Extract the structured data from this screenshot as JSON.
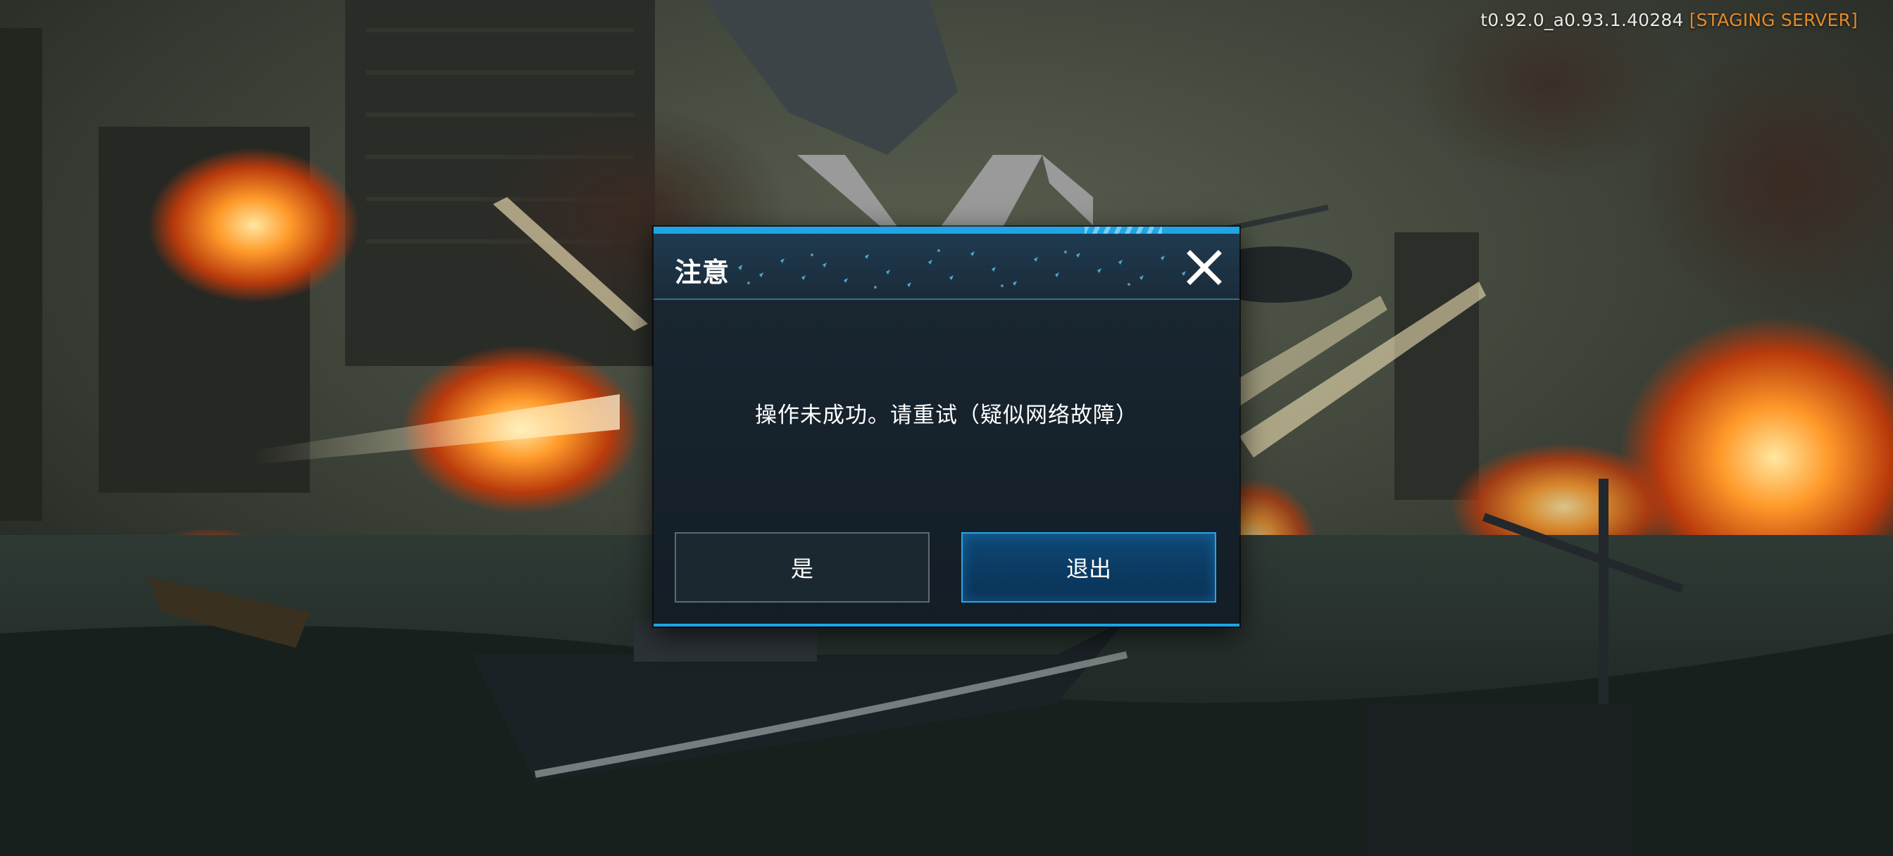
{
  "build": {
    "version": "t0.92.0_a0.93.1.40284",
    "server_tag": "[STAGING SERVER]"
  },
  "dialog": {
    "title": "注意",
    "message": "操作未成功。请重试（疑似网络故障）",
    "confirm_label": "是",
    "exit_label": "退出",
    "close_icon": "close-icon"
  },
  "colors": {
    "accent": "#1fa4e6",
    "server_tag": "#e48a2a",
    "dialog_bg": "#16222c"
  }
}
